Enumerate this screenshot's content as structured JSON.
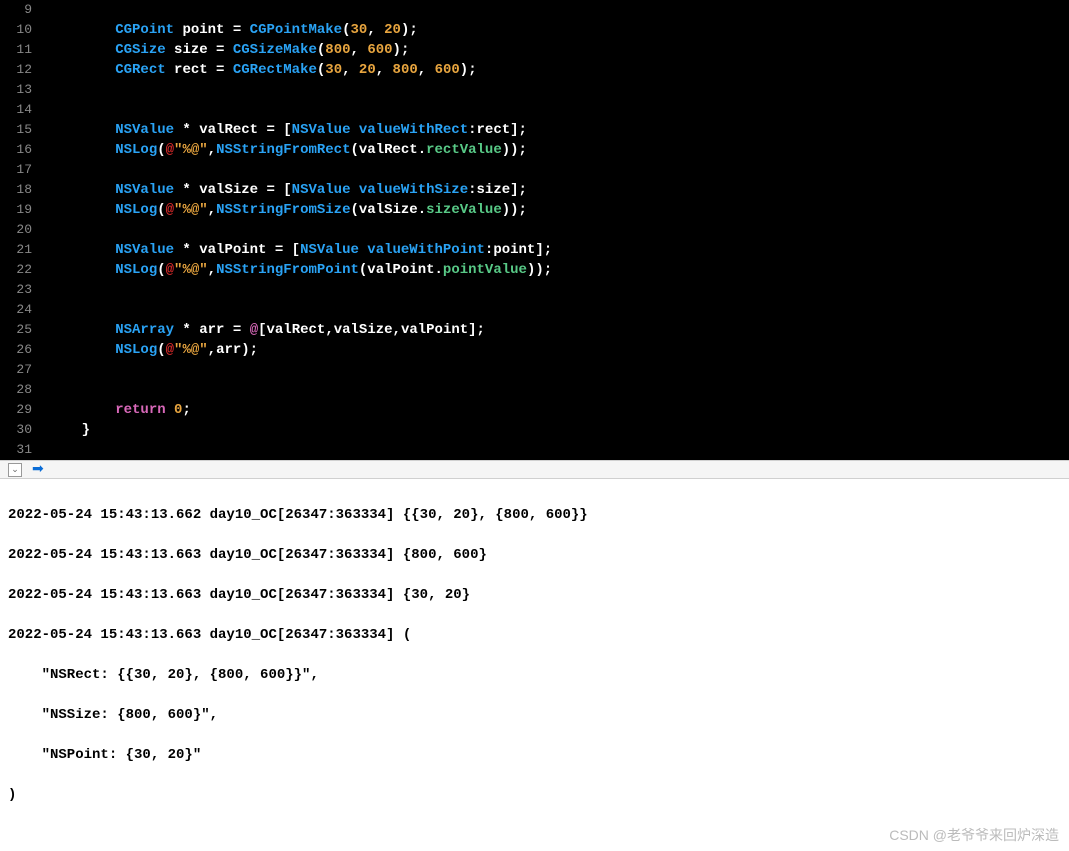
{
  "gutter": [
    "9",
    "10",
    "11",
    "12",
    "13",
    "14",
    "15",
    "16",
    "17",
    "18",
    "19",
    "20",
    "21",
    "22",
    "23",
    "24",
    "25",
    "26",
    "27",
    "28",
    "29",
    "30",
    "31"
  ],
  "code": {
    "l10": {
      "indent": "        ",
      "t1": "CGPoint",
      "sp1": " ",
      "id1": "point",
      "eq": " = ",
      "fn": "CGPointMake",
      "p": "(",
      "n1": "30",
      "c1": ", ",
      "n2": "20",
      "end": ");"
    },
    "l11": {
      "indent": "        ",
      "t1": "CGSize",
      "sp1": " ",
      "id1": "size",
      "eq": " = ",
      "fn": "CGSizeMake",
      "p": "(",
      "n1": "800",
      "c1": ", ",
      "n2": "600",
      "end": ");"
    },
    "l12": {
      "indent": "        ",
      "t1": "CGRect",
      "sp1": " ",
      "id1": "rect",
      "eq": " = ",
      "fn": "CGRectMake",
      "p": "(",
      "n1": "30",
      "c1": ", ",
      "n2": "20",
      "c2": ", ",
      "n3": "800",
      "c3": ", ",
      "n4": "600",
      "end": ");"
    },
    "l15": {
      "indent": "        ",
      "t1": "NSValue",
      "star": " * ",
      "id1": "valRect",
      "eq": " = [",
      "t2": "NSValue",
      "sp": " ",
      "sel": "valueWithRect",
      "col": ":",
      "arg": "rect",
      "end": "];"
    },
    "l16": {
      "indent": "        ",
      "fn": "NSLog",
      "p": "(",
      "at": "@",
      "s": "\"%@\"",
      "c": ",",
      "fn2": "NSStringFromRect",
      "p2": "(",
      "arg": "valRect",
      "dot": ".",
      "mem": "rectValue",
      "end": "));"
    },
    "l18": {
      "indent": "        ",
      "t1": "NSValue",
      "star": " * ",
      "id1": "valSize",
      "eq": " = [",
      "t2": "NSValue",
      "sp": " ",
      "sel": "valueWithSize",
      "col": ":",
      "arg": "size",
      "end": "];"
    },
    "l19": {
      "indent": "        ",
      "fn": "NSLog",
      "p": "(",
      "at": "@",
      "s": "\"%@\"",
      "c": ",",
      "fn2": "NSStringFromSize",
      "p2": "(",
      "arg": "valSize",
      "dot": ".",
      "mem": "sizeValue",
      "end": "));"
    },
    "l21": {
      "indent": "        ",
      "t1": "NSValue",
      "star": " * ",
      "id1": "valPoint",
      "eq": " = [",
      "t2": "NSValue",
      "sp": " ",
      "sel": "valueWithPoint",
      "col": ":",
      "arg": "point",
      "end": "];"
    },
    "l22": {
      "indent": "        ",
      "fn": "NSLog",
      "p": "(",
      "at": "@",
      "s": "\"%@\"",
      "c": ",",
      "fn2": "NSStringFromPoint",
      "p2": "(",
      "arg": "valPoint",
      "dot": ".",
      "mem": "pointValue",
      "end": "));"
    },
    "l25": {
      "indent": "        ",
      "t1": "NSArray",
      "star": " * ",
      "id1": "arr",
      "eq": " = ",
      "at": "@",
      "br": "[",
      "a1": "valRect",
      "c1": ",",
      "a2": "valSize",
      "c2": ",",
      "a3": "valPoint",
      "end": "];"
    },
    "l26": {
      "indent": "        ",
      "fn": "NSLog",
      "p": "(",
      "at": "@",
      "s": "\"%@\"",
      "c": ",",
      "arg": "arr",
      "end": ");"
    },
    "l29": {
      "indent": "        ",
      "kw": "return",
      "sp": " ",
      "n": "0",
      "end": ";"
    },
    "l30": {
      "indent": "    ",
      "br": "}"
    }
  },
  "console": {
    "lines": [
      "2022-05-24 15:43:13.662 day10_OC[26347:363334] {{30, 20}, {800, 600}}",
      "2022-05-24 15:43:13.663 day10_OC[26347:363334] {800, 600}",
      "2022-05-24 15:43:13.663 day10_OC[26347:363334] {30, 20}",
      "2022-05-24 15:43:13.663 day10_OC[26347:363334] (",
      "    \"NSRect: {{30, 20}, {800, 600}}\",",
      "    \"NSSize: {800, 600}\",",
      "    \"NSPoint: {30, 20}\"",
      ")"
    ]
  },
  "watermark": "CSDN @老爷爷来回炉深造"
}
